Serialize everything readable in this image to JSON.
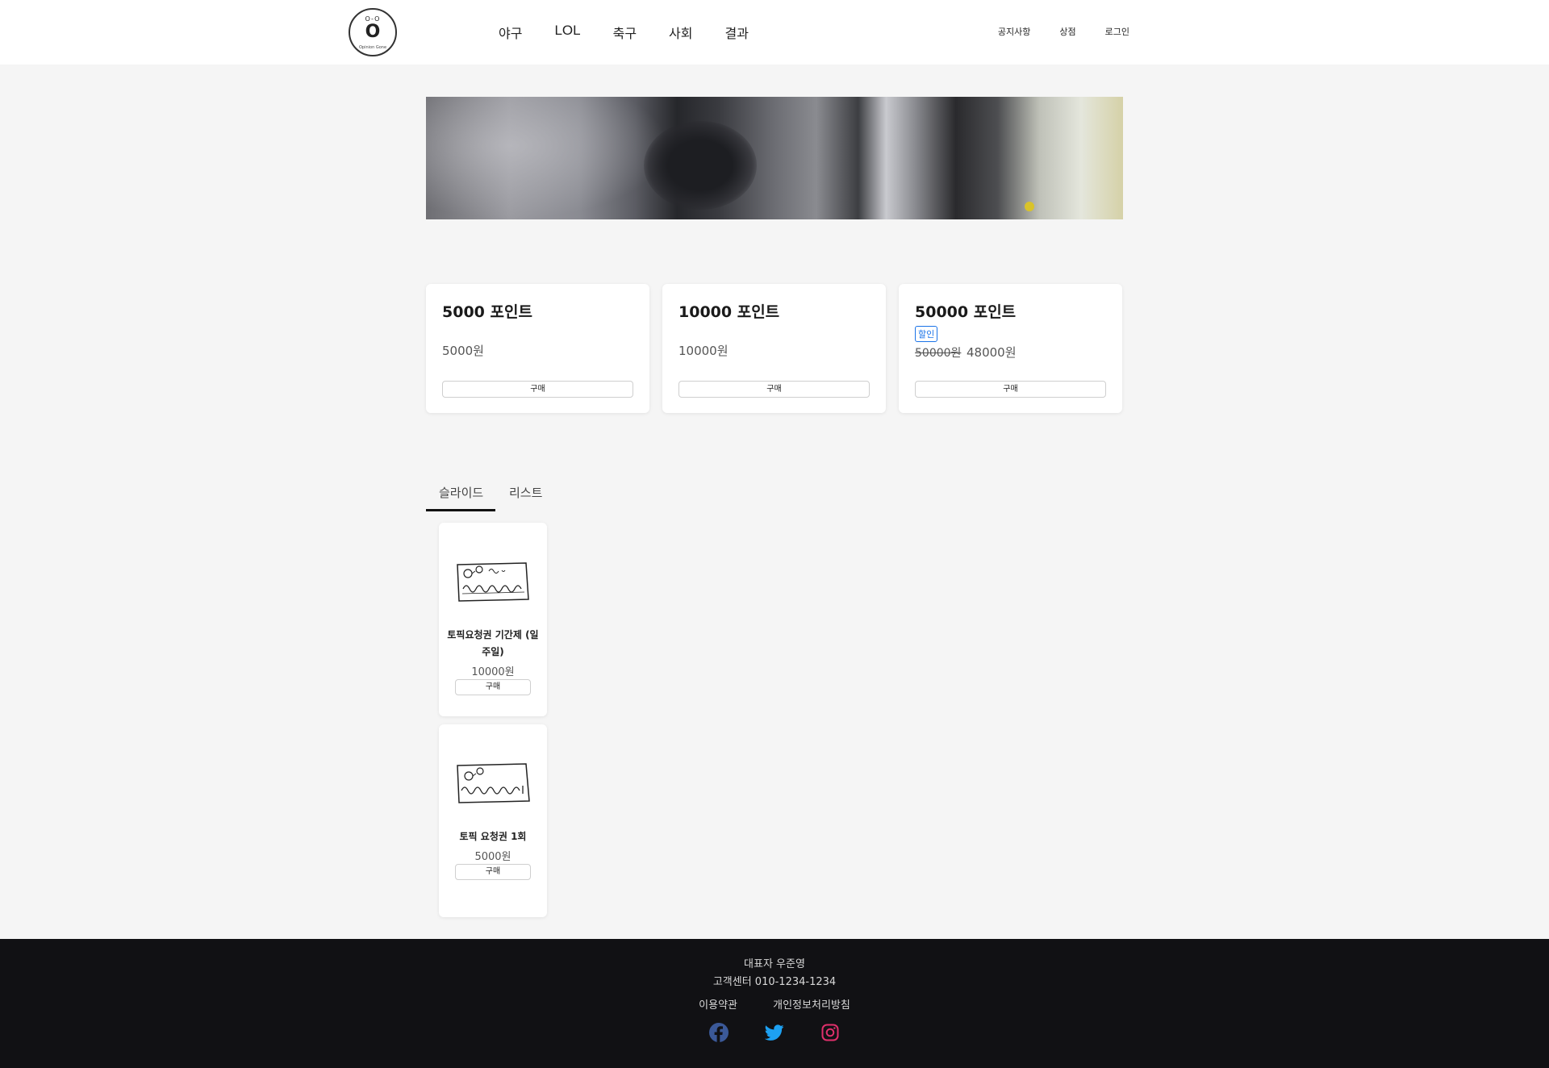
{
  "header": {
    "logo": {
      "eyes": "O-O",
      "letter": "O",
      "caption": "Opinion Gone"
    },
    "nav": [
      "야구",
      "LOL",
      "축구",
      "사회",
      "결과"
    ],
    "util": [
      "공지사항",
      "상점",
      "로그인"
    ]
  },
  "points": [
    {
      "title": "5000 포인트",
      "price": "5000원",
      "buy": "구매"
    },
    {
      "title": "10000 포인트",
      "price": "10000원",
      "buy": "구매"
    },
    {
      "title": "50000 포인트",
      "badge": "할인",
      "old_price": "50000원",
      "price": "48000원",
      "buy": "구매"
    }
  ],
  "tabs": {
    "active": "슬라이드",
    "inactive": "리스트"
  },
  "items": [
    {
      "name": "토픽요청권 기간제 (일주일)",
      "price": "10000원",
      "buy": "구매"
    },
    {
      "name": "토픽 요청권 1회",
      "price": "5000원",
      "buy": "구매"
    }
  ],
  "footer": {
    "ceo": "대표자 우준영",
    "cs": "고객센터 010-1234-1234",
    "links": [
      "이용약관",
      "개인정보처리방침"
    ]
  },
  "colors": {
    "accent": "#1a73e8",
    "footer_bg": "#111114",
    "facebook": "#3b5998",
    "twitter": "#1da1f2",
    "instagram": "#e1306c"
  },
  "icons": [
    "facebook-icon",
    "twitter-icon",
    "instagram-icon"
  ]
}
